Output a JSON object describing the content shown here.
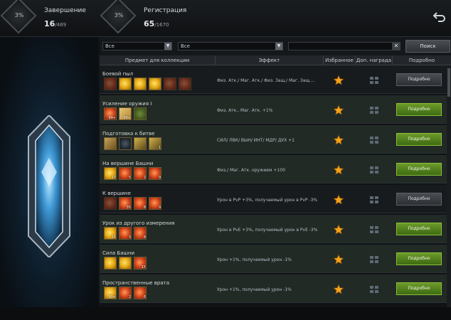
{
  "top": {
    "completion": {
      "percent": "3%",
      "title": "Завершение",
      "value": "16",
      "total": "/469"
    },
    "registration": {
      "percent": "3%",
      "title": "Регистрация",
      "value": "65",
      "total": "/1670"
    }
  },
  "filters": {
    "select1": "Все",
    "select2": "Все",
    "search_placeholder": "",
    "search_button": "Поиск"
  },
  "headers": {
    "item": "Предмет для коллекции",
    "effect": "Эффект",
    "favorite": "Избранное",
    "reward": "Доп. награда",
    "detail": "Подробно"
  },
  "rows": [
    {
      "name": "Боевой пыл",
      "effect": "Физ. Атк./ Маг. Атк./ Физ. Защ./ Маг. Защ....",
      "button": "Подробно",
      "state": "gray",
      "items": [
        {
          "type": "i-red i-dim",
          "qty": ""
        },
        {
          "type": "i-gold",
          "qty": ""
        },
        {
          "type": "i-gold",
          "qty": ""
        },
        {
          "type": "i-gold",
          "qty": ""
        },
        {
          "type": "i-red i-dim",
          "qty": ""
        },
        {
          "type": "i-red i-dim",
          "qty": ""
        }
      ]
    },
    {
      "name": "Усиление оружия I",
      "effect": "Физ. Атк., Маг. Атк. +1%",
      "button": "Подробно",
      "state": "green",
      "items": [
        {
          "type": "i-red",
          "qty": "99+"
        },
        {
          "type": "i-ticket",
          "qty": "99+"
        },
        {
          "type": "i-clover",
          "qty": ""
        }
      ]
    },
    {
      "name": "Подготовка к битве",
      "effect": "СИЛ/ ЛВК/ ВЫН/ ИНТ/ МДР/ ДУХ +1",
      "button": "Подробно",
      "state": "green",
      "items": [
        {
          "type": "i-box",
          "qty": ""
        },
        {
          "type": "i-gear",
          "qty": ""
        },
        {
          "type": "i-shield",
          "qty": ""
        },
        {
          "type": "i-shield",
          "qty": "1"
        }
      ]
    },
    {
      "name": "На вершине Башни",
      "effect": "Физ./ Маг. Атк. оружием +100",
      "button": "Подробно",
      "state": "green",
      "items": [
        {
          "type": "i-gold",
          "qty": "17"
        },
        {
          "type": "i-red",
          "qty": "5"
        },
        {
          "type": "i-red",
          "qty": "2"
        },
        {
          "type": "i-red",
          "qty": "9"
        }
      ]
    },
    {
      "name": "К вершине",
      "effect": "Урон в PvP +3%, получаемый урон в PvP -3%",
      "button": "Подробно",
      "state": "gray",
      "items": [
        {
          "type": "i-red i-dim",
          "qty": ""
        },
        {
          "type": "i-red",
          "qty": "35"
        },
        {
          "type": "i-red",
          "qty": "8"
        },
        {
          "type": "i-red",
          "qty": "9"
        }
      ]
    },
    {
      "name": "Урок из другого измерения",
      "effect": "Урон в PvE +3%, получаемый урон в PvE -3%",
      "button": "Подробно",
      "state": "green",
      "items": [
        {
          "type": "i-gold",
          "qty": "15"
        },
        {
          "type": "i-red",
          "qty": "3"
        },
        {
          "type": "i-red",
          "qty": "8"
        }
      ]
    },
    {
      "name": "Сила Башни",
      "effect": "Урон +1%, получаемый урон -1%",
      "button": "Подробно",
      "state": "green",
      "items": [
        {
          "type": "i-gold",
          "qty": ""
        },
        {
          "type": "i-gold",
          "qty": ""
        },
        {
          "type": "i-red",
          "qty": "15"
        }
      ]
    },
    {
      "name": "Пространственные врата",
      "effect": "Урон +1%, получаемый урон -1%",
      "button": "Подробно",
      "state": "green",
      "items": [
        {
          "type": "i-gold",
          "qty": "99+"
        },
        {
          "type": "i-red",
          "qty": "2"
        },
        {
          "type": "i-red",
          "qty": "6"
        }
      ]
    }
  ],
  "colors": {
    "accent_green": "#6c9a2a",
    "star": "#f3a21b"
  }
}
